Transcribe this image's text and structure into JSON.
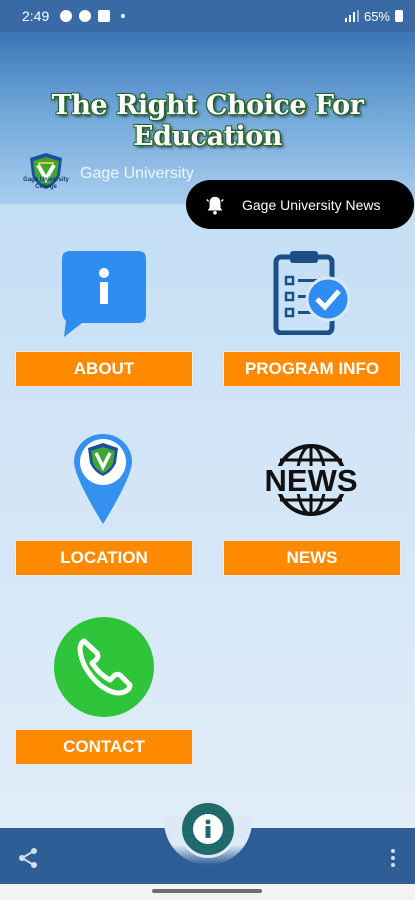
{
  "status_bar": {
    "time": "2:49",
    "battery": "65%"
  },
  "banner": {
    "title": "The Right Choice For Education",
    "university_name": "Gage University",
    "logo_text": "Gage University College"
  },
  "notification": {
    "label": "Gage University News",
    "icon": "bell-icon"
  },
  "tiles": [
    {
      "label": "ABOUT",
      "icon": "info-chat-icon"
    },
    {
      "label": "PROGRAM INFO",
      "icon": "clipboard-check-icon"
    },
    {
      "label": "LOCATION",
      "icon": "map-pin-icon"
    },
    {
      "label": "NEWS",
      "icon": "news-globe-icon"
    },
    {
      "label": "CONTACT",
      "icon": "phone-icon"
    }
  ],
  "bottom_bar": {
    "share_icon": "share-icon",
    "fab_icon": "info-icon",
    "more_icon": "more-vertical-icon"
  },
  "colors": {
    "button": "#ff8a00",
    "bottom_bar": "#2f5e96",
    "fab": "#1f6a6a",
    "status_bar": "#3a6aa6"
  }
}
